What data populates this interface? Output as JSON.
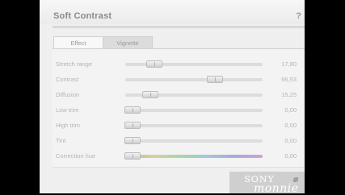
{
  "panel": {
    "title": "Soft Contrast",
    "help_label": "?"
  },
  "tabs": [
    {
      "label": "Effect",
      "active": true
    },
    {
      "label": "Vignette",
      "active": false
    }
  ],
  "sliders": [
    {
      "label": "Stretch range",
      "value": "17,80",
      "fraction": 0.18
    },
    {
      "label": "Contrast",
      "value": "66,53",
      "fraction": 0.67
    },
    {
      "label": "Diffusion",
      "value": "15,25",
      "fraction": 0.15
    },
    {
      "label": "Low trim",
      "value": "0,00",
      "fraction": 0.0
    },
    {
      "label": "High trim",
      "value": "0,00",
      "fraction": 0.0
    },
    {
      "label": "Tint",
      "value": "0,00",
      "fraction": 0.0
    },
    {
      "label": "Correction hue",
      "value": "0,00",
      "fraction": 0.0
    }
  ],
  "watermark": {
    "brand": "SONY",
    "name": "monnie"
  }
}
